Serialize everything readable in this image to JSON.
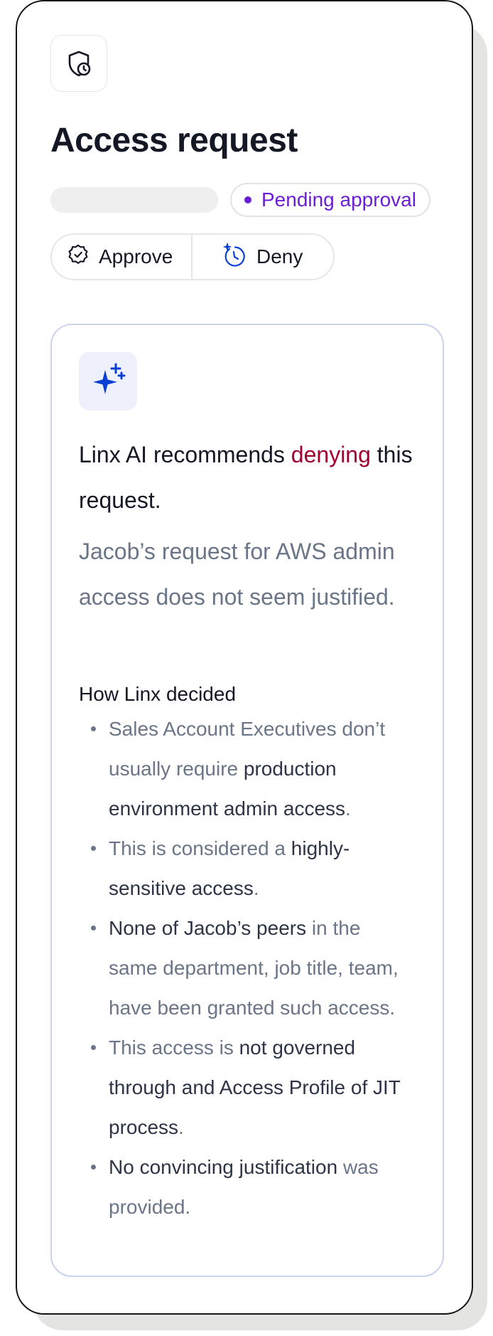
{
  "header": {
    "icon": "shield-clock-icon",
    "title": "Access request",
    "status_badge": "Pending approval"
  },
  "actions": {
    "approve_label": "Approve",
    "approve_icon": "badge-check-icon",
    "deny_label": "Deny",
    "deny_icon": "sparkle-clock-icon"
  },
  "ai_panel": {
    "icon": "sparkles-icon",
    "headline_prefix": "Linx AI recommends ",
    "headline_verdict": "denying",
    "headline_suffix": " this request.",
    "summary": "Jacob’s request for AWS admin access does not seem justified.",
    "reasons_heading": "How Linx decided",
    "reasons": [
      {
        "a": "Sales Account Executives don’t usually require ",
        "b": "production environment admin access",
        "c": "."
      },
      {
        "a": "This is considered a ",
        "b": "highly-sensitive access",
        "c": "."
      },
      {
        "a": "",
        "b": "None of Jacob’s peers",
        "c": " in the same department, job title, team, have been granted such access."
      },
      {
        "a": "This access is ",
        "b": "not governed through and Access Profile of JIT process",
        "c": "."
      },
      {
        "a": "",
        "b": "No convincing justification",
        "c": " was provided."
      }
    ]
  },
  "colors": {
    "accent_purple": "#6a1fd6",
    "deny_red": "#a3002f",
    "ai_blue": "#0b3fd4",
    "muted_text": "#6a7587"
  }
}
